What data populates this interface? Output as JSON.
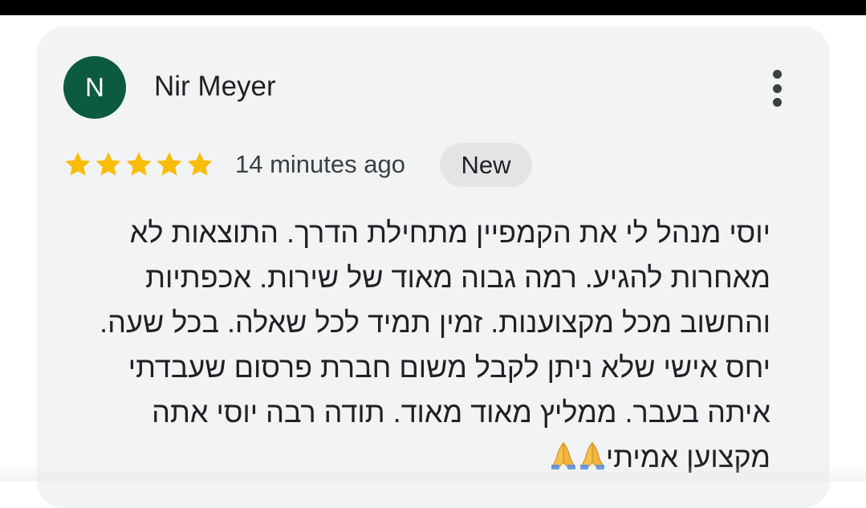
{
  "review": {
    "avatar_initial": "N",
    "avatar_color": "#0c5a3f",
    "reviewer_name": "Nir Meyer",
    "menu_icon": "more-vert-icon",
    "rating": 5,
    "rating_max": 5,
    "star_color": "#fbbc04",
    "timestamp": "14 minutes ago",
    "badge": "New",
    "text_lines": [
      "יוסי מנהל לי את הקמפיין מתחילת הדרך. התוצאות לא",
      "מאחרות להגיע. רמה גבוה מאוד של שירות. אכפתיות",
      "והחשוב מכל מקצוענות. זמין תמיד לכל שאלה. בכל שעה.",
      "יחס אישי שלא ניתן לקבל משום חברת פרסום שעבדתי",
      "איתה בעבר. ממליץ מאוד מאוד. תודה רבה יוסי אתה",
      "מקצוען אמיתי"
    ],
    "trailing_emoji": "folded-hands-icon",
    "trailing_emoji_count": 2
  }
}
